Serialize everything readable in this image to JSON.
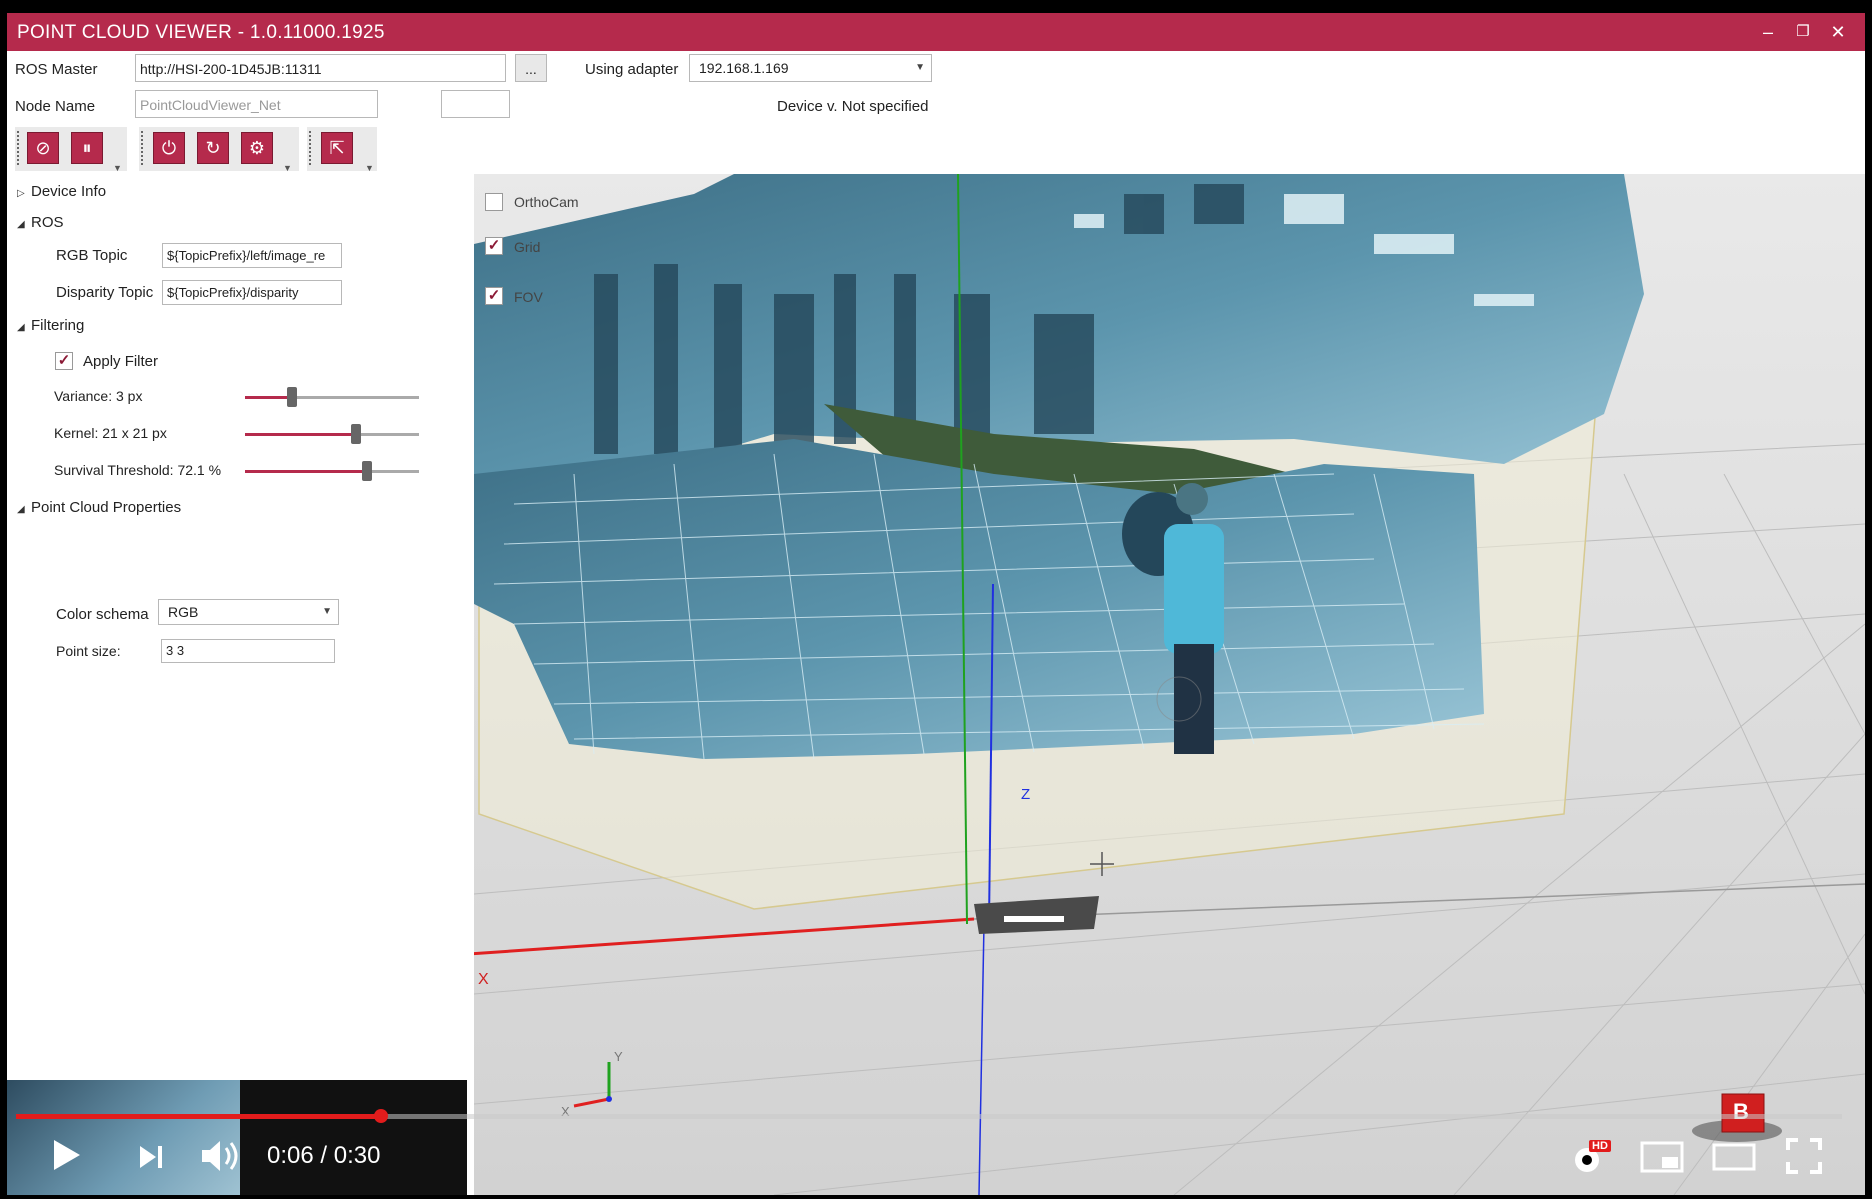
{
  "window": {
    "title": "POINT CLOUD VIEWER - 1.0.11000.1925",
    "minimize": "–",
    "restore": "❐",
    "close": "✕"
  },
  "connection": {
    "ros_master_label": "ROS Master",
    "ros_master_value": "http://HSI-200-1D45JB:11311",
    "browse_button": "...",
    "adapter_label": "Using adapter",
    "adapter_value": "192.168.1.169",
    "node_name_label": "Node Name",
    "node_name_placeholder": "PointCloudViewer_Net",
    "device_version": "Device v. Not specified"
  },
  "toolbar": {
    "icons": [
      "unlink-icon",
      "pause-icon",
      "power-icon",
      "refresh-icon",
      "gear-icon",
      "export-icon"
    ]
  },
  "panel": {
    "device_info": "Device Info",
    "ros": "ROS",
    "rgb_topic_label": "RGB Topic",
    "rgb_topic_value": "${TopicPrefix}/left/image_re",
    "disparity_topic_label": "Disparity Topic",
    "disparity_topic_value": "${TopicPrefix}/disparity",
    "filtering": "Filtering",
    "apply_filter_label": "Apply Filter",
    "apply_filter_checked": true,
    "variance_label": "Variance: 3 px",
    "variance_level": 0.27,
    "kernel_label": "Kernel: 21 x 21 px",
    "kernel_level": 0.64,
    "survival_label": "Survival Threshold: 72.1 %",
    "survival_level": 0.7,
    "point_cloud_properties": "Point Cloud Properties",
    "color_schema_label": "Color schema",
    "color_schema_value": "RGB",
    "point_size_label": "Point size:",
    "point_size_value": "3 3"
  },
  "viewport": {
    "orthocam_label": "OrthoCam",
    "orthocam_checked": false,
    "grid_label": "Grid",
    "grid_checked": true,
    "fov_label": "FOV",
    "fov_checked": true,
    "axis_x": "X",
    "axis_z": "Z",
    "gizmo_x": "X",
    "gizmo_y": "Y",
    "cube_label": "B"
  },
  "video": {
    "timecode": "0:06 / 0:30",
    "progress": 0.2,
    "hd_badge": "HD"
  },
  "colors": {
    "accent": "#b52a4c",
    "progress": "#e21c1c"
  }
}
